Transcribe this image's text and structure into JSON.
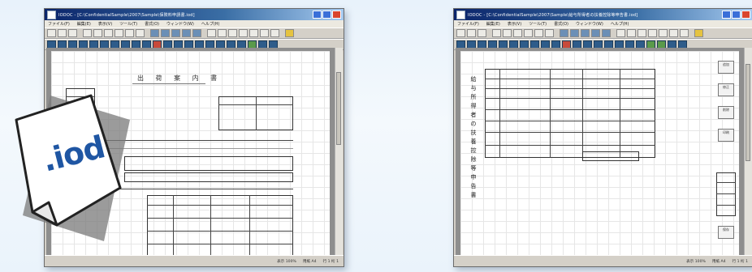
{
  "left_window": {
    "title": "IODOC - [C:\\ConfidentialSample\\2007\\Sample\\保険料申請書.iod]",
    "menu": [
      "ファイル(F)",
      "編集(E)",
      "表示(V)",
      "ツール(T)",
      "書式(O)",
      "ウィンドウ(W)",
      "ヘルプ(H)"
    ],
    "document_title": "出 荷 案 内 書",
    "status": [
      "表示 100%",
      "用紙 A4",
      "行 1 桁 1"
    ]
  },
  "right_window": {
    "title": "IODOC - [C:\\ConfidentialSample\\2007\\Sample\\給与所得者の扶養控除等申告書.iod]",
    "menu": [
      "ファイル(F)",
      "編集(E)",
      "表示(V)",
      "ツール(T)",
      "書式(O)",
      "ウィンドウ(W)",
      "ヘルプ(H)"
    ],
    "vertical_title": "給与所得者の扶養控除等申告書",
    "side_buttons": [
      "追加",
      "修正",
      "削除",
      "印刷",
      "保存"
    ],
    "status": [
      "表示 100%",
      "用紙 A4",
      "行 1 桁 1"
    ]
  },
  "file_icon": {
    "label": ".iod"
  },
  "colors": {
    "titlebar_start": "#0a246a",
    "titlebar_end": "#a6caf0",
    "iod_label": "#1f56a3",
    "background": "#e8f2fb"
  }
}
